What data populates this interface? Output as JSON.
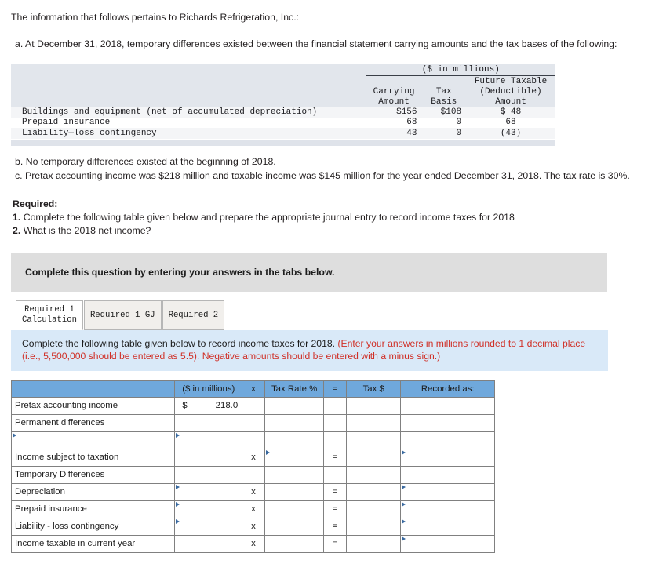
{
  "intro": {
    "lead": "The information that follows pertains to Richards Refrigeration, Inc.:",
    "item_a_marker": "a.",
    "item_a": "At December 31, 2018, temporary differences existed between the financial statement carrying amounts and the tax bases of the following:",
    "item_b_marker": "b.",
    "item_b": "No temporary differences existed at the beginning of 2018.",
    "item_c_marker": "c.",
    "item_c": "Pretax accounting income was $218 million and taxable income was $145 million for the year ended December 31, 2018. The tax rate is 30%."
  },
  "facts_table": {
    "caption": "($ in millions)",
    "col_headers": {
      "carrying_line1": "Carrying",
      "carrying_line2": "Amount",
      "basis_line1": "Tax",
      "basis_line2": "Basis",
      "future_line1": "Future Taxable",
      "future_line2": "(Deductible)",
      "future_line3": "Amount"
    },
    "rows": [
      {
        "label": "Buildings and equipment (net of accumulated depreciation)",
        "carrying": "$156",
        "basis": "$108",
        "future": "$ 48"
      },
      {
        "label": "Prepaid insurance",
        "carrying": "68",
        "basis": "0",
        "future": "68"
      },
      {
        "label": "Liability—loss contingency",
        "carrying": "43",
        "basis": "0",
        "future": "(43)"
      }
    ]
  },
  "required": {
    "heading": "Required:",
    "item1_num": "1.",
    "item1": "Complete the following table given below and prepare the appropriate journal entry to record income taxes for 2018",
    "item2_num": "2.",
    "item2": "What is the 2018 net income?"
  },
  "gray_callout": {
    "text": "Complete this question by entering your answers in the tabs below."
  },
  "tabs": [
    {
      "line1": "Required 1",
      "line2": "Calculation",
      "active": true
    },
    {
      "line1": "Required 1 GJ",
      "line2": "",
      "active": false
    },
    {
      "line1": "Required 2",
      "line2": "",
      "active": false
    }
  ],
  "blue_note": {
    "black_part": "Complete the following table given below to record income taxes for 2018. ",
    "red_part": "(Enter your answers in millions rounded to 1 decimal place (i.e., 5,500,000 should be entered as 5.5). Negative amounts should be entered with a minus sign.)"
  },
  "answer_grid": {
    "headers": [
      "",
      "($ in millions)",
      "x",
      "Tax Rate %",
      "=",
      "Tax $",
      "Recorded as:"
    ],
    "rows": [
      {
        "label": "Pretax accounting income",
        "dollar": "$",
        "amount": "218.0",
        "mult": "",
        "rate": "",
        "eq": "",
        "tax": "",
        "recorded": ""
      },
      {
        "label": "Permanent differences",
        "dollar": "",
        "amount": "",
        "mult": "",
        "rate": "",
        "eq": "",
        "tax": "",
        "recorded": ""
      },
      {
        "label": "",
        "dollar": "",
        "amount": "",
        "mult": "",
        "rate": "",
        "eq": "",
        "tax": "",
        "recorded": ""
      },
      {
        "label": "Income subject to taxation",
        "dollar": "",
        "amount": "",
        "mult": "x",
        "rate": "",
        "eq": "=",
        "tax": "",
        "recorded": ""
      },
      {
        "label": "Temporary Differences",
        "dollar": "",
        "amount": "",
        "mult": "",
        "rate": "",
        "eq": "",
        "tax": "",
        "recorded": ""
      },
      {
        "label": "Depreciation",
        "dollar": "",
        "amount": "",
        "mult": "x",
        "rate": "",
        "eq": "=",
        "tax": "",
        "recorded": ""
      },
      {
        "label": "Prepaid insurance",
        "dollar": "",
        "amount": "",
        "mult": "x",
        "rate": "",
        "eq": "=",
        "tax": "",
        "recorded": ""
      },
      {
        "label": "Liability - loss contingency",
        "dollar": "",
        "amount": "",
        "mult": "x",
        "rate": "",
        "eq": "=",
        "tax": "",
        "recorded": ""
      },
      {
        "label": "Income taxable in current year",
        "dollar": "",
        "amount": "",
        "mult": "x",
        "rate": "",
        "eq": "=",
        "tax": "",
        "recorded": ""
      }
    ]
  },
  "colors": {
    "header_blue": "#6fa8dc",
    "note_blue": "#d9e9f8",
    "callout_gray": "#dedede",
    "red_text": "#d03027",
    "comment_marker": "#39699f"
  }
}
